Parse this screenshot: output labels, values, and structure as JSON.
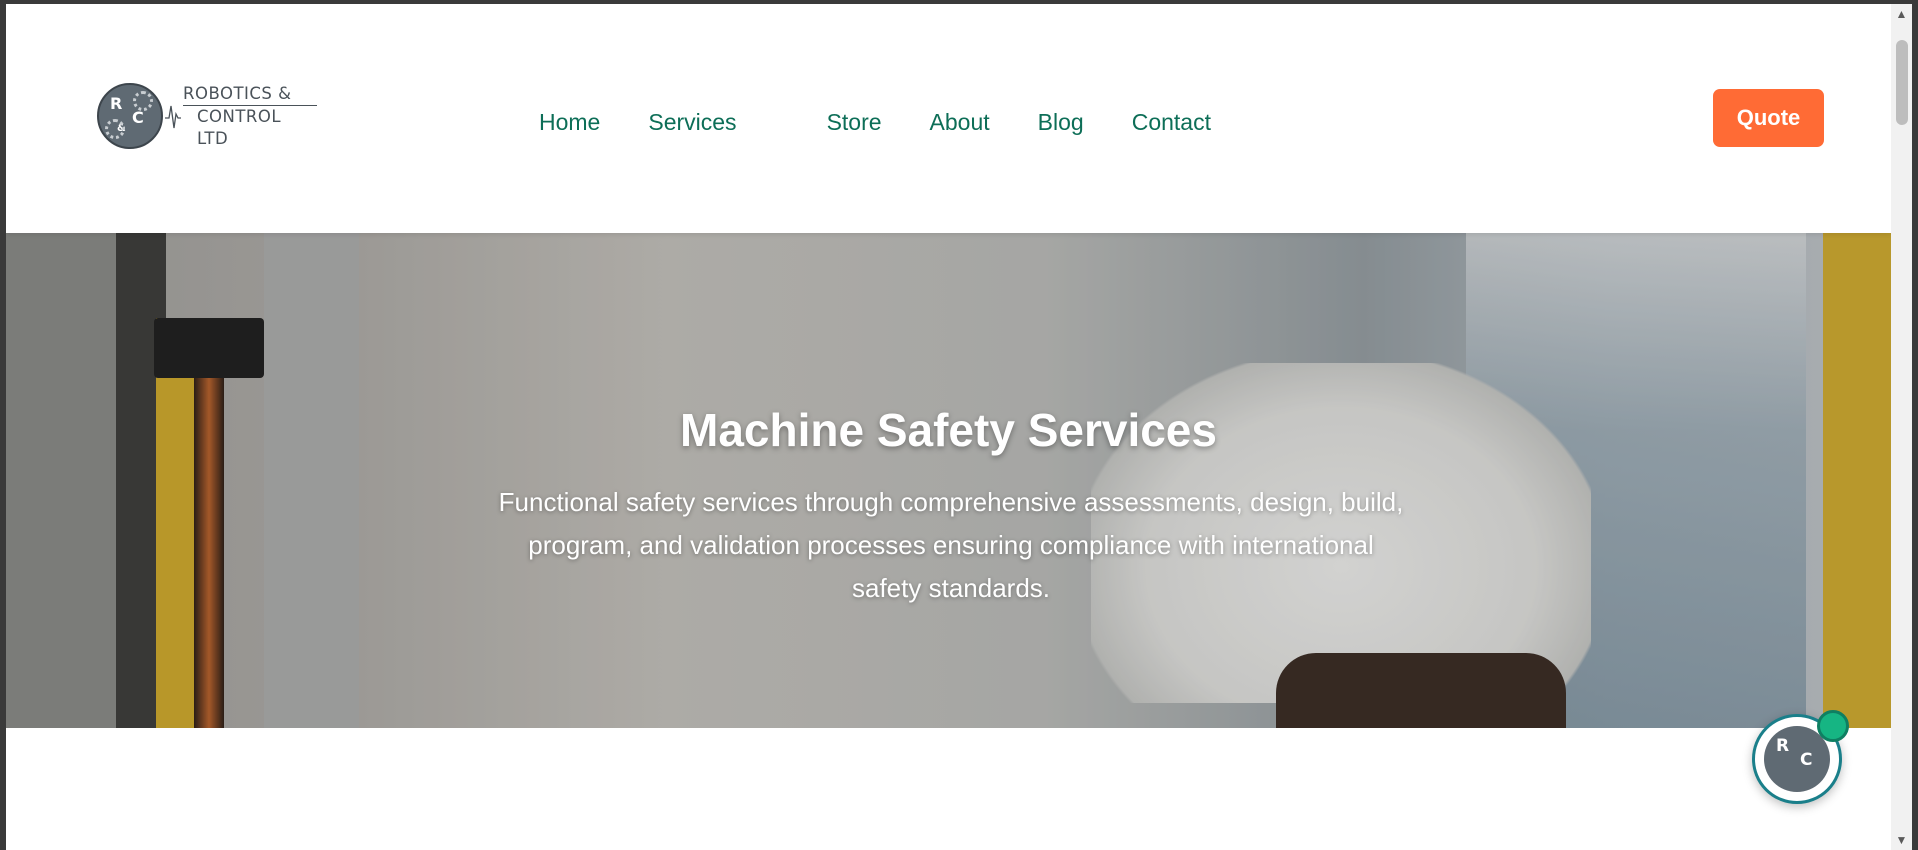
{
  "brand": {
    "logo_initials": [
      "R",
      "C",
      "&"
    ],
    "name_line1": "ROBOTICS &",
    "name_line2": "CONTROL LTD"
  },
  "nav": {
    "items": [
      {
        "label": "Home"
      },
      {
        "label": "Services"
      },
      {
        "label": "Store"
      },
      {
        "label": "About"
      },
      {
        "label": "Blog"
      },
      {
        "label": "Contact"
      }
    ]
  },
  "header": {
    "quote_label": "Quote"
  },
  "hero": {
    "title": "Machine Safety Services",
    "subtitle": "Functional safety services through comprehensive assessments, design, build, program, and validation processes ensuring compliance with international safety standards."
  },
  "colors": {
    "nav_text": "#0d6e57",
    "accent": "#ff6b35",
    "online": "#16b583",
    "widget_ring": "#1a7f8a"
  },
  "icons": {
    "chat": "chat-avatar-icon",
    "scroll_up": "scroll-up-arrow-icon",
    "scroll_down": "scroll-down-arrow-icon"
  }
}
